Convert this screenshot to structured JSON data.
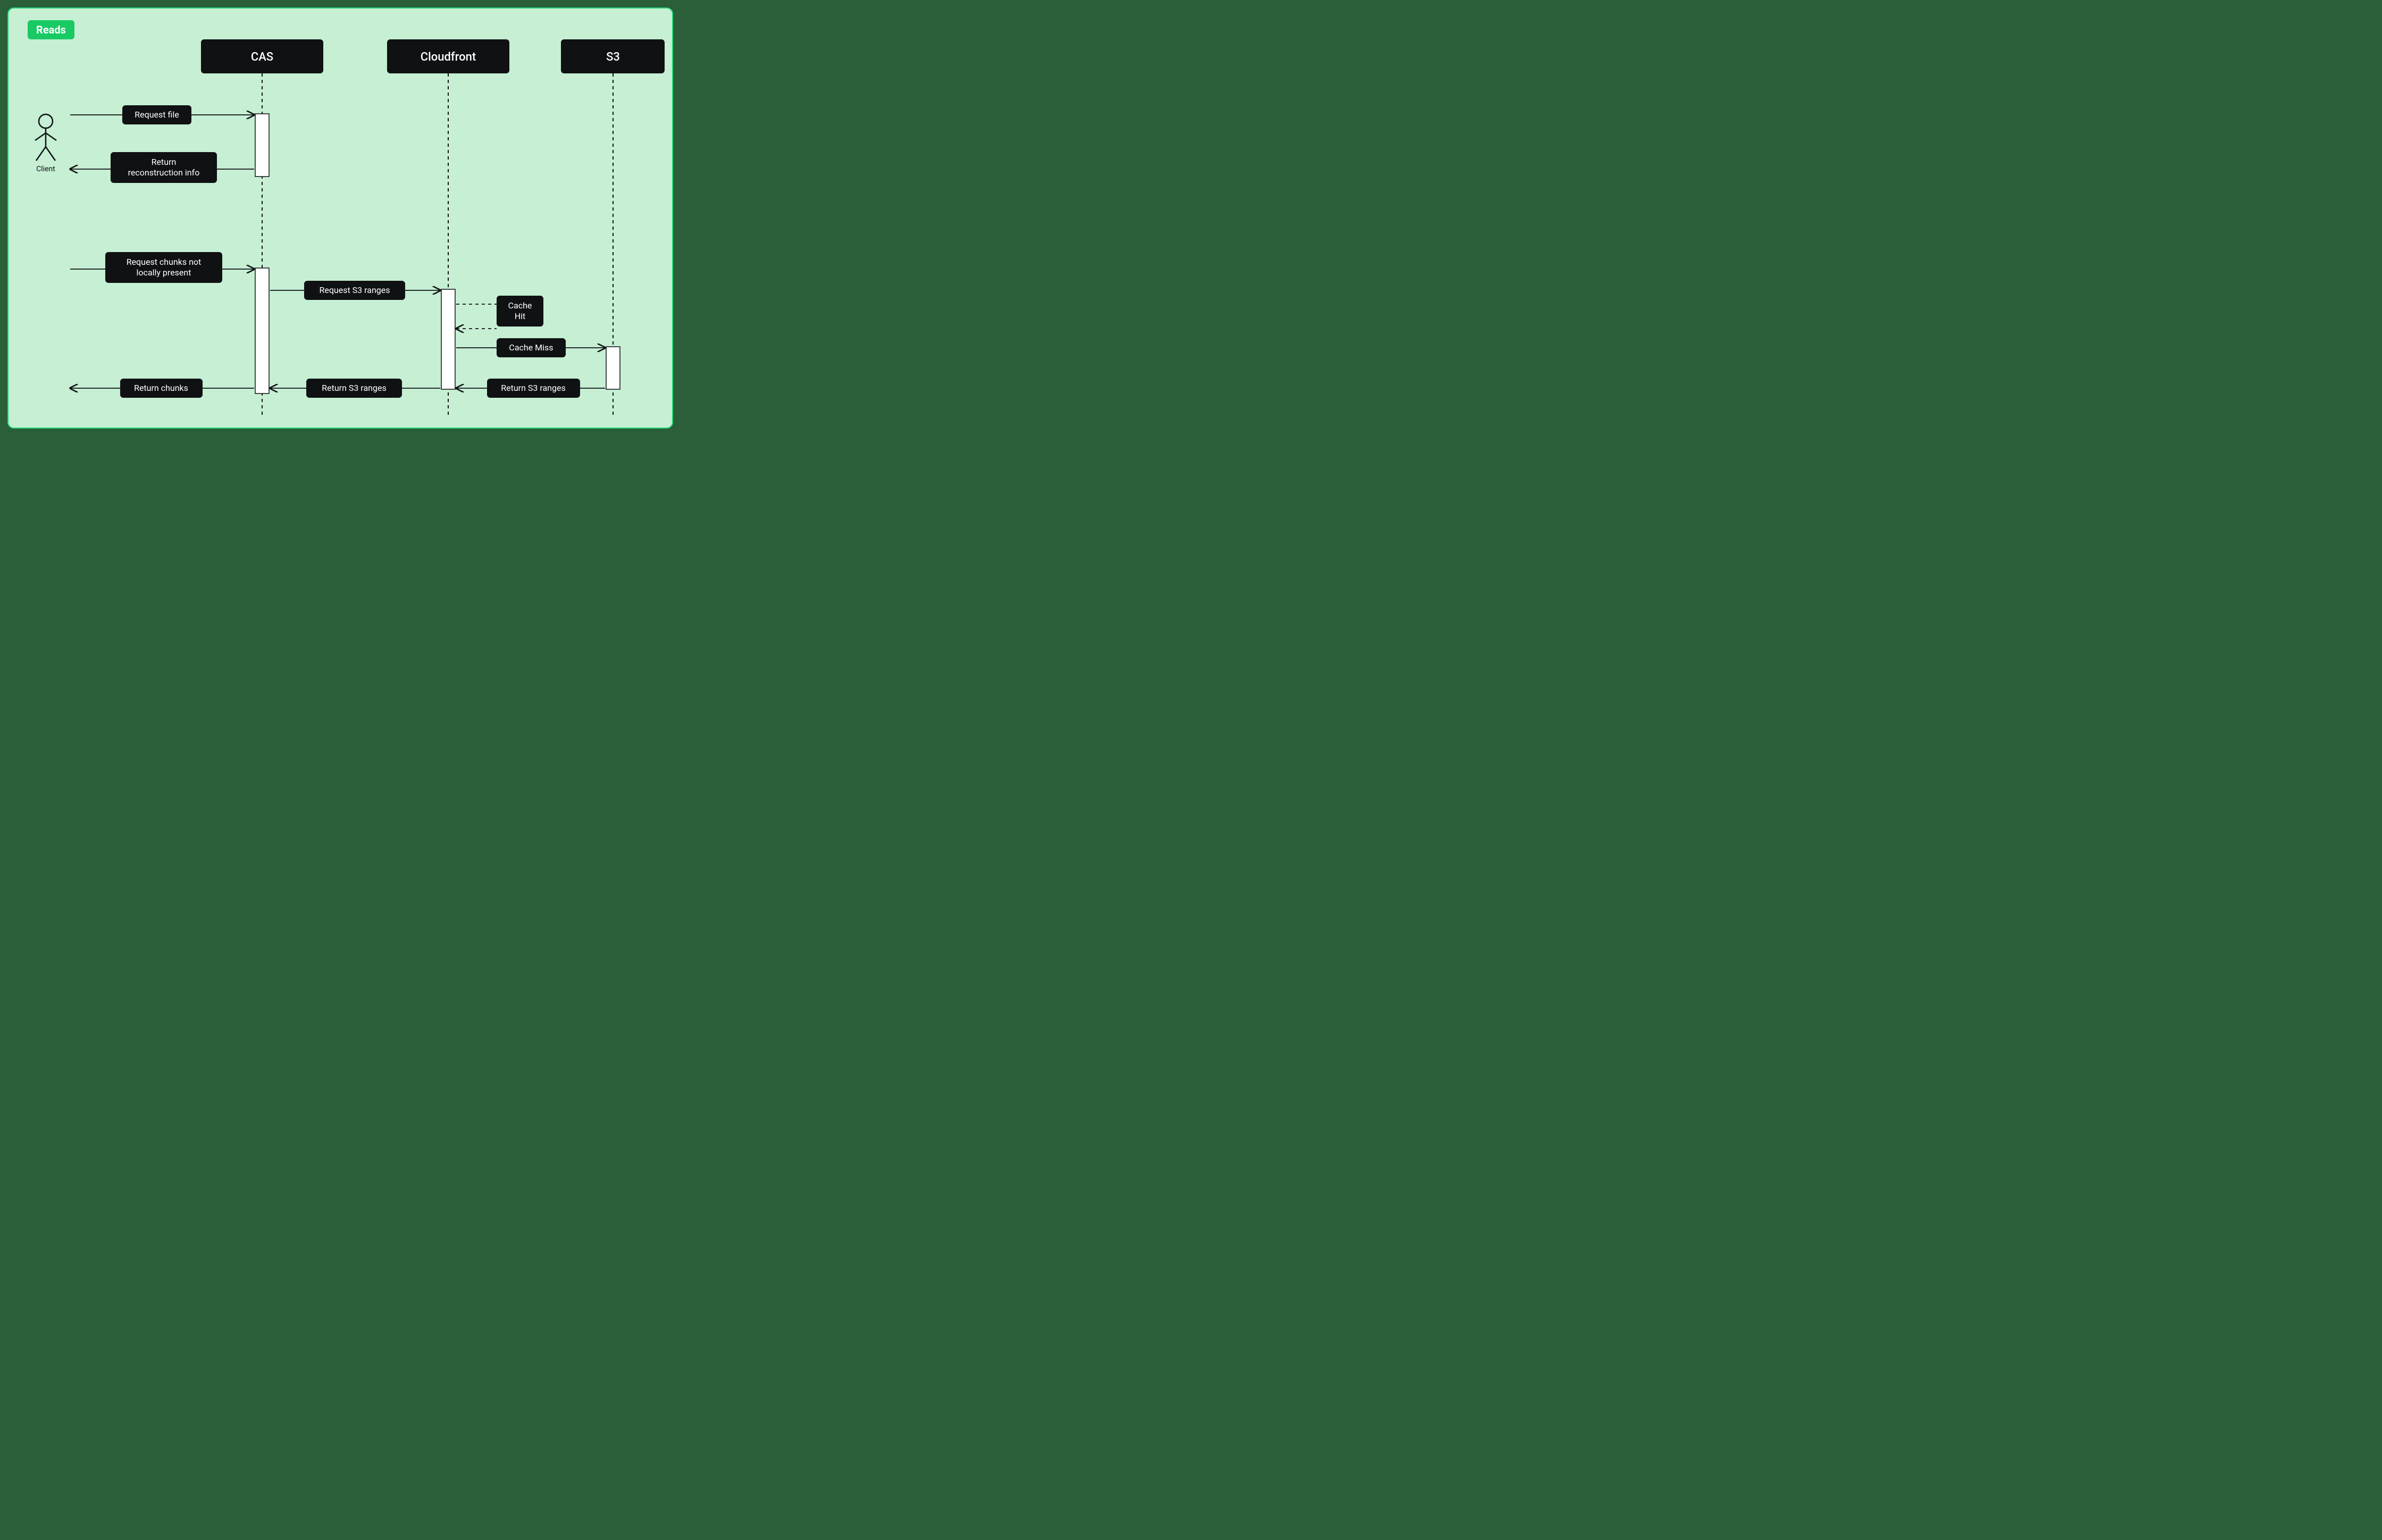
{
  "title": "Reads",
  "actor": {
    "label": "Client"
  },
  "participants": {
    "cas": "CAS",
    "cloudfront": "Cloudfront",
    "s3": "S3"
  },
  "messages": {
    "request_file": "Request file",
    "return_reconstruction": "Return\nreconstruction info",
    "request_chunks": "Request chunks not\nlocally present",
    "request_s3_ranges": "Request S3 ranges",
    "cache_hit": "Cache\nHit",
    "cache_miss": "Cache Miss",
    "return_s3_ranges_s3": "Return S3 ranges",
    "return_s3_ranges_cf": "Return S3 ranges",
    "return_chunks": "Return chunks"
  }
}
